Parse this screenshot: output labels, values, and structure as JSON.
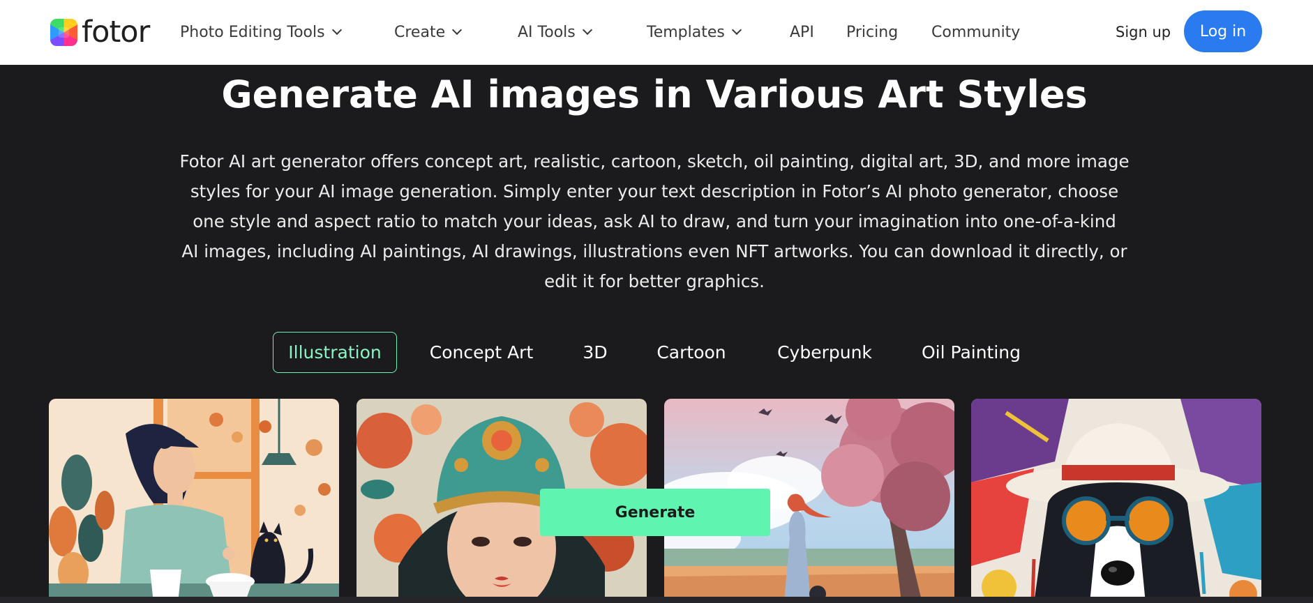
{
  "header": {
    "logo_text": "fotor",
    "nav": [
      {
        "label": "Photo Editing Tools",
        "dropdown": true
      },
      {
        "label": "Create",
        "dropdown": true
      },
      {
        "label": "AI Tools",
        "dropdown": true
      },
      {
        "label": "Templates",
        "dropdown": true
      },
      {
        "label": "API",
        "dropdown": false
      },
      {
        "label": "Pricing",
        "dropdown": false
      },
      {
        "label": "Community",
        "dropdown": false
      }
    ],
    "signup_label": "Sign up",
    "login_label": "Log in"
  },
  "hero": {
    "title": "Generate AI images in Various Art Styles",
    "description_lines": [
      "Fotor AI art generator offers concept art, realistic, cartoon, sketch, oil painting, digital art, 3D, and more image",
      "styles for your AI image generation. Simply enter your text description in Fotor’s AI photo generator, choose",
      "one style and aspect ratio to match your ideas, ask AI to draw, and turn your imagination into one-of-a-kind",
      "AI images, including AI paintings, AI drawings, illustrations even NFT artworks. You can download it directly, or",
      "edit it for better graphics."
    ]
  },
  "tabs": [
    {
      "label": "Illustration",
      "active": true
    },
    {
      "label": "Concept Art",
      "active": false
    },
    {
      "label": "3D",
      "active": false
    },
    {
      "label": "Cartoon",
      "active": false
    },
    {
      "label": "Cyberpunk",
      "active": false
    },
    {
      "label": "Oil Painting",
      "active": false
    }
  ],
  "cards": [
    {
      "subject": "woman-with-cat-illustration"
    },
    {
      "subject": "girl-with-ornate-helmet-illustration"
    },
    {
      "subject": "woman-under-tree-landscape-illustration"
    },
    {
      "subject": "dog-with-sunglasses-and-hat-illustration"
    }
  ],
  "generate_label": "Generate",
  "colors": {
    "background": "#1b1b1d",
    "accent_green": "#5ff5b1",
    "login_blue": "#2b7bf0",
    "active_tab_text": "#8af5c4"
  }
}
